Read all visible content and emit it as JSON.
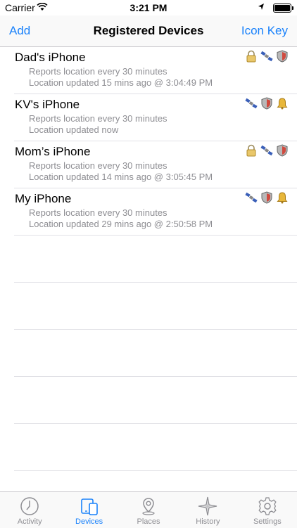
{
  "status_bar": {
    "carrier": "Carrier",
    "time": "3:21 PM",
    "battery_level": 1.0
  },
  "nav": {
    "left_button": "Add",
    "title": "Registered Devices",
    "right_button": "Icon Key"
  },
  "devices": [
    {
      "name": "Dad's iPhone",
      "line1": "Reports location every 30 minutes",
      "line2": "Location updated 15 mins ago @ 3:04:49 PM",
      "icons": [
        "lock-icon",
        "satellite-icon",
        "shield-icon"
      ]
    },
    {
      "name": "KV's iPhone",
      "line1": "Reports location every 30 minutes",
      "line2": "Location updated now",
      "icons": [
        "satellite-icon",
        "shield-icon",
        "bell-icon"
      ]
    },
    {
      "name": "Mom’s iPhone",
      "line1": "Reports location every 30 minutes",
      "line2": "Location updated 14 mins ago @ 3:05:45 PM",
      "icons": [
        "lock-icon",
        "satellite-icon",
        "shield-icon"
      ]
    },
    {
      "name": "My iPhone",
      "line1": "Reports location every 30 minutes",
      "line2": "Location updated 29 mins ago @ 2:50:58 PM",
      "icons": [
        "satellite-icon",
        "shield-icon",
        "bell-icon"
      ]
    }
  ],
  "tabs": [
    {
      "label": "Activity",
      "icon": "clock-icon",
      "active": false
    },
    {
      "label": "Devices",
      "icon": "devices-icon",
      "active": true
    },
    {
      "label": "Places",
      "icon": "map-pin-icon",
      "active": false
    },
    {
      "label": "History",
      "icon": "compass-icon",
      "active": false
    },
    {
      "label": "Settings",
      "icon": "gear-icon",
      "active": false
    }
  ],
  "colors": {
    "accent": "#1a82fb",
    "secondary_text": "#8e8e93",
    "separator": "#e1e1e6"
  }
}
